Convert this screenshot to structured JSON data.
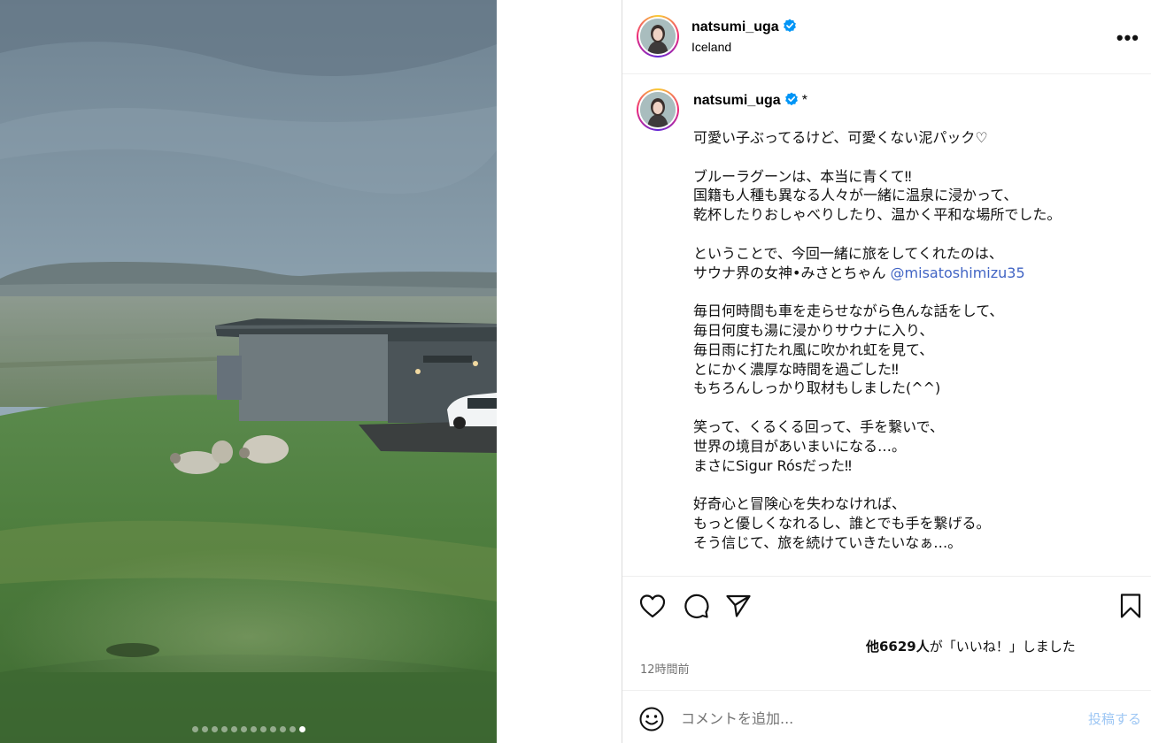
{
  "post": {
    "username": "natsumi_uga",
    "location": "Iceland",
    "more_label": "•••",
    "caption_marker": "*",
    "caption_lines": [
      "可愛い子ぶってるけど、可愛くない泥パック♡",
      "",
      "ブルーラグーンは、本当に青くて‼︎",
      "国籍も人種も異なる人々が一緒に温泉に浸かって、",
      "乾杯したりおしゃべりしたり、温かく平和な場所でした。",
      "",
      "ということで、今回一緒に旅をしてくれたのは、",
      "サウナ界の女神•みさとちゃん ",
      "",
      "毎日何時間も車を走らせながら色んな話をして、",
      "毎日何度も湯に浸かりサウナに入り、",
      "毎日雨に打たれ風に吹かれ虹を見て、",
      "とにかく濃厚な時間を過ごした‼︎",
      "もちろんしっかり取材もしました(^^)",
      "",
      "笑って、くるくる回って、手を繋いで、",
      "世界の境目があいまいになる…。",
      "まさにSigur Rósだった‼︎",
      "",
      "好奇心と冒険心を失わなければ、",
      "もっと優しくなれるし、誰とでも手を繋げる。",
      "そう信じて、旅を続けていきたいなぁ…。"
    ],
    "mention": "@misatoshimizu35",
    "likes_count": "他6629人",
    "likes_suffix": "が「いいね！」しました",
    "timestamp": "12時間前",
    "carousel": {
      "total": 12,
      "active_index": 11
    }
  },
  "comment": {
    "placeholder": "コメントを追加...",
    "post_label": "投稿する"
  },
  "colors": {
    "mention": "#4164c4",
    "verified": "#0095f6",
    "post_button_disabled": "#9ec7f4",
    "muted_text": "#737373"
  },
  "icons": [
    "verified-badge-icon",
    "more-icon",
    "heart-icon",
    "comment-icon",
    "share-icon",
    "bookmark-icon",
    "emoji-icon"
  ]
}
